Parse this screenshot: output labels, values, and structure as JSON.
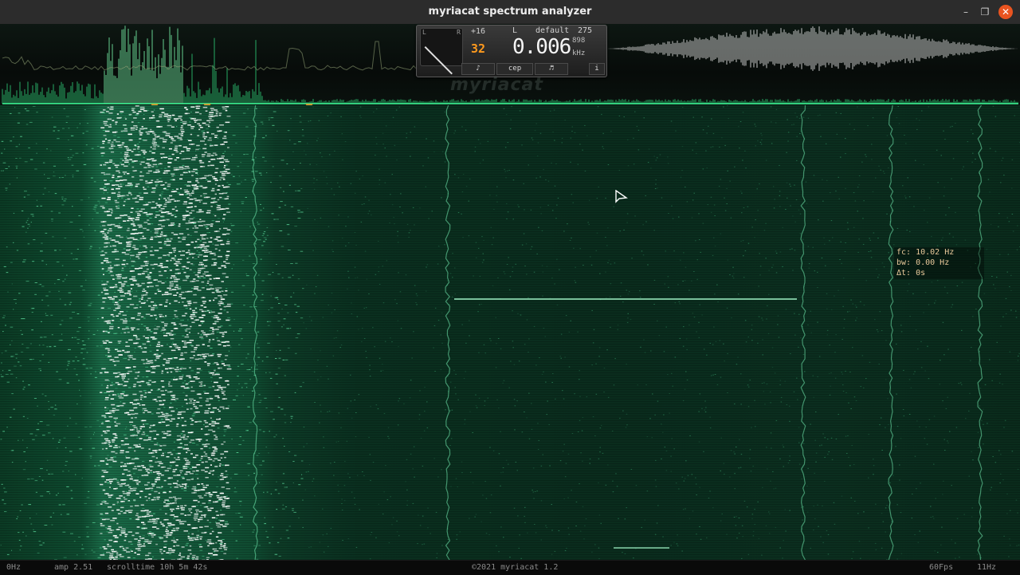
{
  "window": {
    "title": "myriacat spectrum analyzer"
  },
  "window_controls": {
    "minimize": "–",
    "maximize": "❐",
    "close": "✕"
  },
  "meter": {
    "dial_left": "L",
    "dial_right": "R",
    "gain": "+16",
    "resolution": "32",
    "channel": "L",
    "preset": "default",
    "count": "275",
    "frequency": "0.006",
    "frequency_sub": "898",
    "unit": "kHz",
    "buttons": [
      "♪",
      "cep",
      "♬",
      "i"
    ]
  },
  "brand": "myriacat",
  "readout": {
    "fc": "fc: 10.02 Hz",
    "bw": "bw: 0.00 Hz",
    "dt": "Δt: 0s"
  },
  "status": {
    "left_freq": "0Hz",
    "amp": "amp 2.51",
    "scrolltime": "scrolltime 10h 5m 42s",
    "copyright": "©2021 myriacat 1.2",
    "fps": "60Fps",
    "right_freq": "11Hz"
  },
  "colors": {
    "accent": "#3dff9a",
    "marker": "#c8a032",
    "background": "#0a2c1d",
    "close_button": "#e95420"
  }
}
